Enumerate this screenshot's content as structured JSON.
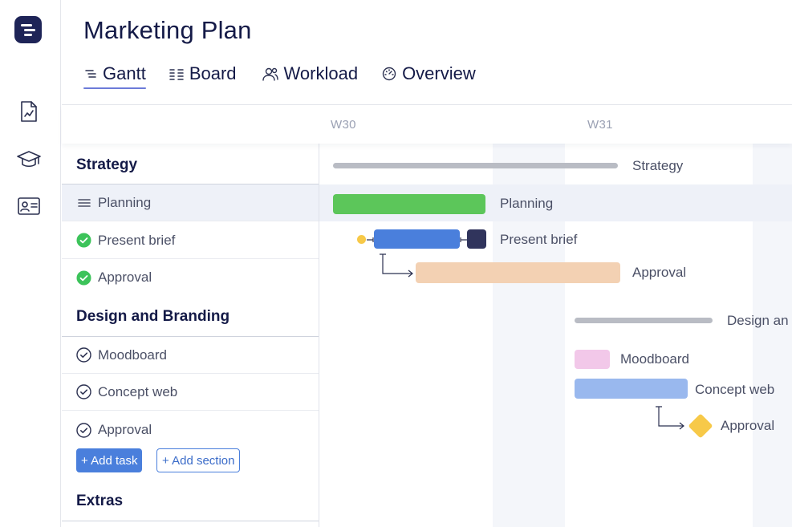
{
  "app": {
    "title": "Marketing Plan"
  },
  "rail": {
    "icons": [
      "app-logo",
      "report-icon",
      "graduation-cap-icon",
      "contact-card-icon"
    ]
  },
  "tabs": [
    {
      "label": "Gantt",
      "icon": "gantt-icon",
      "active": true
    },
    {
      "label": "Board",
      "icon": "board-icon",
      "active": false
    },
    {
      "label": "Workload",
      "icon": "people-icon",
      "active": false
    },
    {
      "label": "Overview",
      "icon": "dashboard-icon",
      "active": false
    }
  ],
  "timeline": {
    "weeks": [
      "W30",
      "W31"
    ]
  },
  "sections": [
    {
      "title": "Strategy",
      "tasks": [
        {
          "label": "Planning",
          "status": "drag-handle",
          "selected": true
        },
        {
          "label": "Present brief",
          "status": "done"
        },
        {
          "label": "Approval",
          "status": "done"
        }
      ]
    },
    {
      "title": "Design and Branding",
      "tasks": [
        {
          "label": "Moodboard",
          "status": "open"
        },
        {
          "label": "Concept web",
          "status": "open"
        },
        {
          "label": "Approval",
          "status": "open"
        }
      ]
    },
    {
      "title": "Extras",
      "tasks": []
    }
  ],
  "actions": {
    "add_task": "+ Add task",
    "add_section": "+ Add section"
  },
  "gantt": {
    "strategy_summary": "Strategy",
    "planning": "Planning",
    "present_brief": "Present brief",
    "approval_1": "Approval",
    "design_summary": "Design an",
    "moodboard": "Moodboard",
    "concept_web": "Concept web",
    "approval_2": "Approval"
  },
  "colors": {
    "accent": "#4a7fdc",
    "done_green": "#3cc35a",
    "planning_bar": "#5cc65a",
    "present_bar": "#4a7fdc",
    "approval_bar": "#f3d1b3",
    "moodboard_bar": "#f2c8e9",
    "concept_bar": "#99b8ee",
    "milestone": "#f7c948",
    "summary_bar": "#b9bcc4"
  }
}
